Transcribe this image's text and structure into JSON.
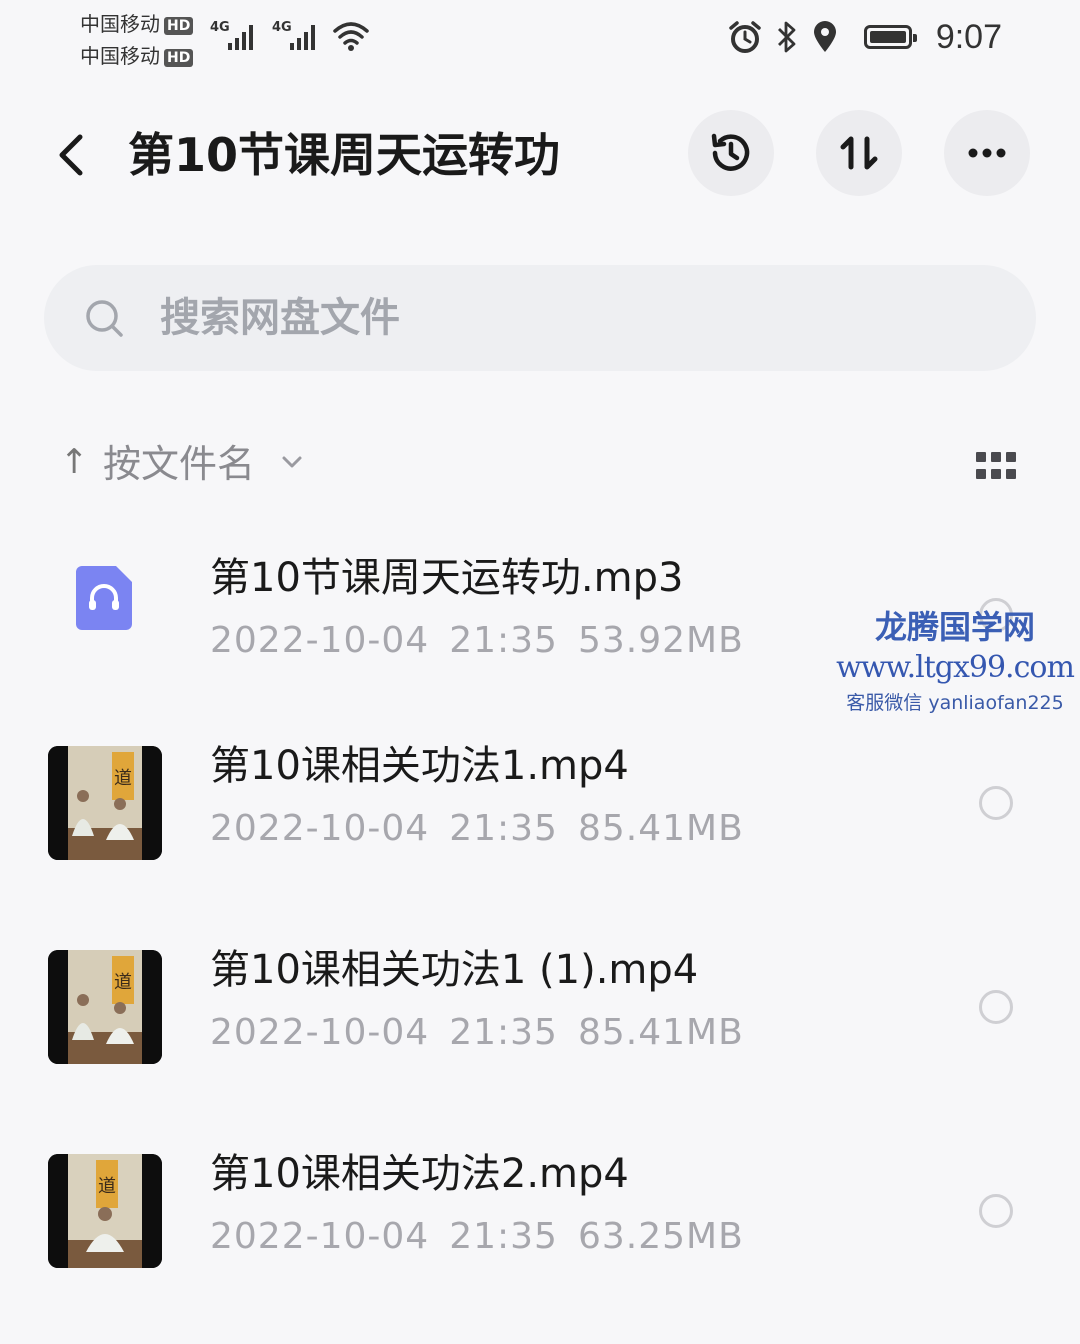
{
  "status_bar": {
    "carrier1": "中国移动",
    "carrier2": "中国移动",
    "hd_badge": "HD",
    "network1": "4G",
    "network2": "4G",
    "time": "9:07",
    "icons": [
      "alarm-icon",
      "bluetooth-icon",
      "location-icon",
      "battery-icon",
      "wifi-icon"
    ]
  },
  "header": {
    "title": "第10节课周天运转功",
    "buttons": [
      "history-icon",
      "transfer-icon",
      "more-icon"
    ]
  },
  "search": {
    "placeholder": "搜索网盘文件"
  },
  "sort": {
    "label": "按文件名"
  },
  "files": [
    {
      "name": "第10节课周天运转功.mp3",
      "date": "2022-10-04",
      "time": "21:35",
      "size": "53.92MB",
      "type": "audio"
    },
    {
      "name": "第10课相关功法1.mp4",
      "date": "2022-10-04",
      "time": "21:35",
      "size": "85.41MB",
      "type": "video"
    },
    {
      "name": "第10课相关功法1 (1).mp4",
      "date": "2022-10-04",
      "time": "21:35",
      "size": "85.41MB",
      "type": "video"
    },
    {
      "name": "第10课相关功法2.mp4",
      "date": "2022-10-04",
      "time": "21:35",
      "size": "63.25MB",
      "type": "video"
    }
  ],
  "watermark": {
    "line1": "龙腾国学网",
    "line2": "www.ltgx99.com",
    "line3": "客服微信 yanliaofan225"
  },
  "colors": {
    "background": "#f7f7f9",
    "audio_icon": "#7b84f2",
    "watermark": "#3b5fb5"
  }
}
